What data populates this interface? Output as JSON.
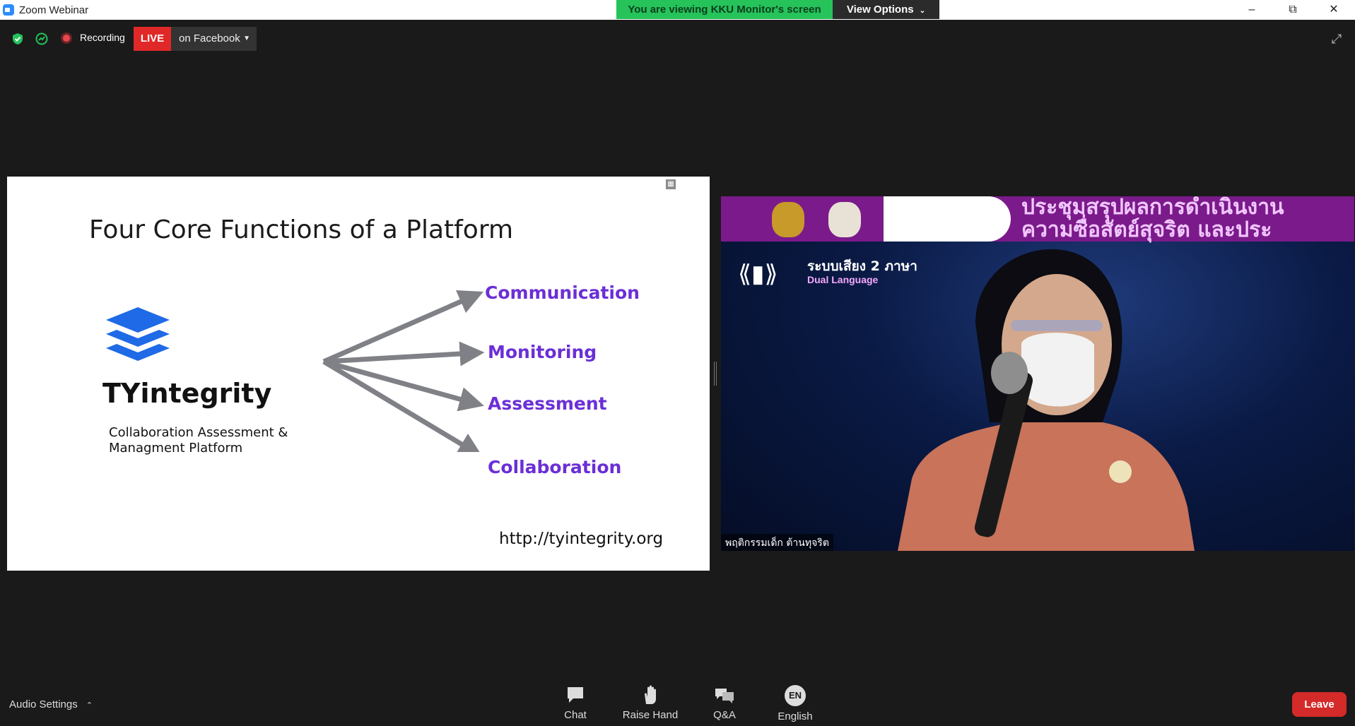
{
  "window": {
    "title": "Zoom Webinar",
    "share_banner": "You are viewing KKU Monitor's screen",
    "view_options": "View Options"
  },
  "status": {
    "recording": "Recording",
    "live": "LIVE",
    "live_target": "on Facebook"
  },
  "slide": {
    "title": "Four Core Functions of a Platform",
    "brand": "TYintegrity",
    "tagline_1": "Collaboration Assessment &",
    "tagline_2": "Managment Platform",
    "functions": [
      "Communication",
      "Monitoring",
      "Assessment",
      "Collaboration"
    ],
    "url": "http://tyintegrity.org",
    "accent_color": "#6b2fd6"
  },
  "video": {
    "banner_line_1": "ประชุมสรุปผลการดำเนินงาน",
    "banner_line_2": "ความซื่อสัตย์สุจริต และประ",
    "lang_line_1": "ระบบเสียง 2 ภาษา",
    "lang_line_2": "Dual Language",
    "name_tag": "พฤติกรรมเด็ก ต้านทุจริต"
  },
  "toolbar": {
    "audio_settings": "Audio Settings",
    "chat": "Chat",
    "raise_hand": "Raise Hand",
    "qa": "Q&A",
    "language_badge": "EN",
    "language": "English",
    "leave": "Leave"
  }
}
